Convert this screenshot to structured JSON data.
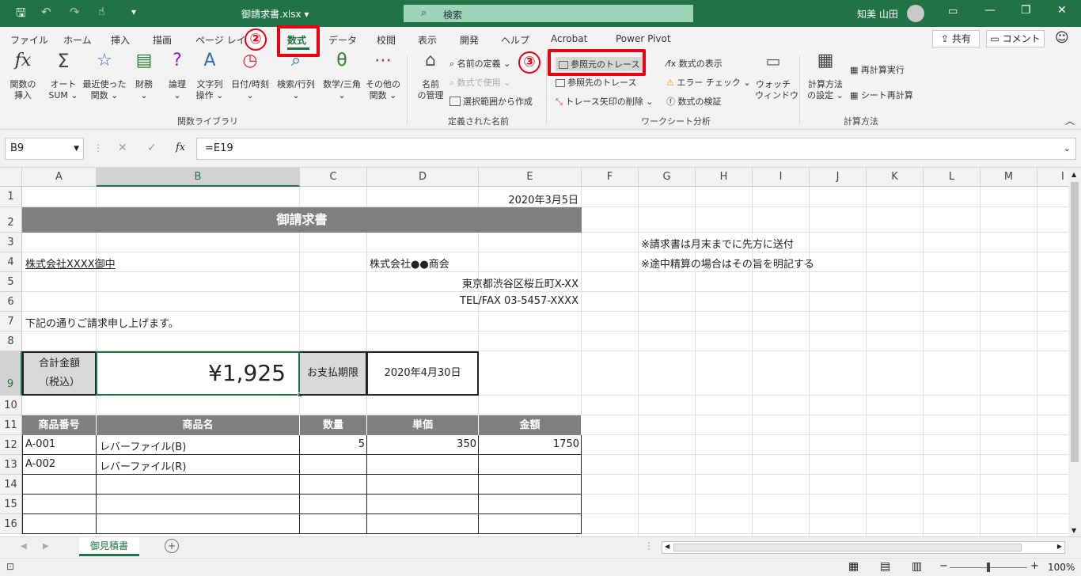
{
  "titlebar": {
    "filename": "御請求書.xlsx",
    "dropdown_arrow": "⌄",
    "search_placeholder": "検索",
    "user_name": "知美 山田",
    "qat_icons": [
      "save-icon",
      "undo-icon",
      "redo-icon",
      "touch-mode-icon",
      "customize-icon"
    ]
  },
  "menu": {
    "tabs": [
      "ファイル",
      "ホーム",
      "挿入",
      "描画",
      "ページ レイ",
      "数式",
      "データ",
      "校閲",
      "表示",
      "開発",
      "ヘルプ",
      "Acrobat",
      "Power Pivot"
    ],
    "active": "数式",
    "share": "共有",
    "comment": "コメント"
  },
  "ribbon": {
    "function_library": {
      "label": "関数ライブラリ",
      "buttons": [
        {
          "icon": "fx",
          "l1": "関数の",
          "l2": "挿入"
        },
        {
          "icon": "Σ",
          "l1": "オート",
          "l2": "SUM ⌄"
        },
        {
          "icon": "☆",
          "l1": "最近使った",
          "l2": "関数 ⌄"
        },
        {
          "icon": "▤",
          "l1": "財務",
          "l2": "⌄"
        },
        {
          "icon": "?",
          "l1": "論理",
          "l2": "⌄"
        },
        {
          "icon": "A",
          "l1": "文字列",
          "l2": "操作 ⌄"
        },
        {
          "icon": "◷",
          "l1": "日付/時刻",
          "l2": "⌄"
        },
        {
          "icon": "⌕",
          "l1": "検索/行列",
          "l2": "⌄"
        },
        {
          "icon": "θ",
          "l1": "数学/三角",
          "l2": "⌄"
        },
        {
          "icon": "⋯",
          "l1": "その他の",
          "l2": "関数 ⌄"
        }
      ]
    },
    "defined_names": {
      "label": "定義された名前",
      "name_manager_l1": "名前",
      "name_manager_l2": "の管理",
      "define_name": "名前の定義",
      "use_in_formula": "数式で使用",
      "create_from_selection": "選択範囲から作成"
    },
    "formula_auditing": {
      "label": "ワークシート分析",
      "trace_precedents": "参照元のトレース",
      "trace_dependents": "参照先のトレース",
      "remove_arrows": "トレース矢印の削除",
      "show_formulas": "数式の表示",
      "error_checking": "エラー チェック",
      "evaluate_formula": "数式の検証",
      "watch_l1": "ウォッチ",
      "watch_l2": "ウィンドウ"
    },
    "calculation": {
      "label": "計算方法",
      "options_l1": "計算方法",
      "options_l2": "の設定 ⌄",
      "calc_now": "再計算実行",
      "calc_sheet": "シート再計算"
    }
  },
  "formula_bar": {
    "name_box": "B9",
    "formula": "=E19",
    "fx": "fx",
    "cancel": "✕",
    "enter": "✓"
  },
  "grid": {
    "columns": [
      "A",
      "B",
      "C",
      "D",
      "E",
      "F",
      "G",
      "H",
      "I",
      "J",
      "K",
      "L",
      "M",
      "I"
    ],
    "rows": [
      "1",
      "2",
      "3",
      "4",
      "5",
      "6",
      "7",
      "8",
      "9",
      "10",
      "11",
      "12",
      "13",
      "14",
      "15",
      "16"
    ],
    "cells": {
      "e1": "2020年3月5日",
      "title": "御請求書",
      "g3": "※請求書は月末までに先方に送付",
      "a4": "株式会社XXXX御中",
      "d4": "株式会社●●商会",
      "e5": "東京都渋谷区桜丘町X-XX",
      "e6": "TEL/FAX 03-5457-XXXX",
      "a7": "下記の通りご請求申し上げます。",
      "g4": "※途中精算の場合はその旨を明記する",
      "a9_1": "合計金額",
      "a9_2": "（税込）",
      "b9": "¥1,925",
      "c9": "お支払期限",
      "d9": "2020年4月30日"
    },
    "table_headers": [
      "商品番号",
      "商品名",
      "数量",
      "単価",
      "金額"
    ],
    "table_rows": [
      {
        "no": "A-001",
        "name": "レバーファイル(B)",
        "qty": "5",
        "price": "350",
        "amount": "1750"
      },
      {
        "no": "A-002",
        "name": "レバーファイル(R)",
        "qty": "",
        "price": "",
        "amount": ""
      }
    ]
  },
  "sheet_tab": "御見積書",
  "status": {
    "zoom": "100%"
  },
  "annotations": {
    "step2": "②",
    "step3": "③"
  }
}
